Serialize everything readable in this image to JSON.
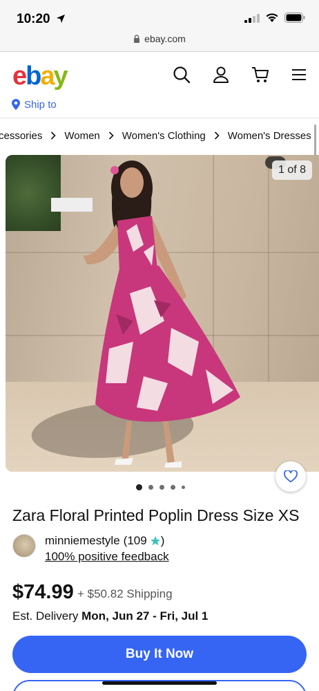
{
  "status": {
    "time": "10:20"
  },
  "browser": {
    "url": "ebay.com"
  },
  "header": {
    "logo_letters": [
      "e",
      "b",
      "a",
      "y"
    ],
    "logo_colors": [
      "#e53238",
      "#0064d2",
      "#f5af02",
      "#86b817"
    ],
    "ship_to": "Ship to"
  },
  "breadcrumb": {
    "items": [
      "cessories",
      "Women",
      "Women's Clothing",
      "Women's Dresses"
    ]
  },
  "gallery": {
    "counter": "1 of 8",
    "image_count": 8,
    "current_index": 1
  },
  "listing": {
    "title": "Zara Floral Printed Poplin Dress Size XS",
    "seller_name": "minniemestyle",
    "seller_score_prefix": "(109",
    "seller_score_suffix": ")",
    "feedback": "100% positive feedback",
    "price": "$74.99",
    "shipping": "+ $50.82 Shipping",
    "delivery_label": "Est. Delivery",
    "delivery_dates": "Mon, Jun 27 - Fri, Jul 1"
  },
  "actions": {
    "buy_now": "Buy It Now"
  },
  "colors": {
    "accent": "#3665f3",
    "star": "#3cc0c0"
  }
}
